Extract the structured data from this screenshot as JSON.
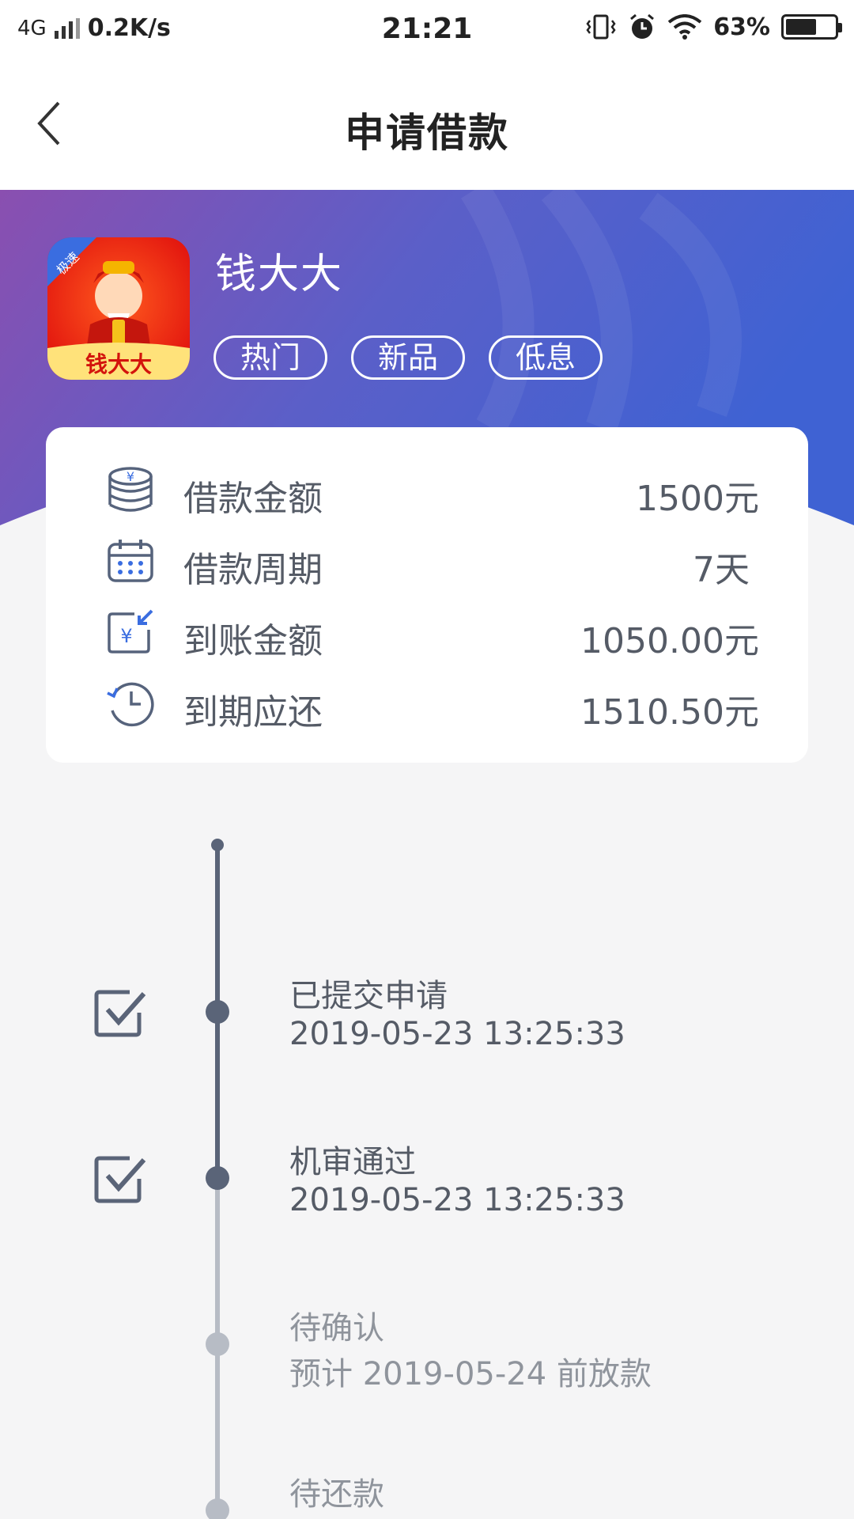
{
  "status_bar": {
    "network": "4G",
    "speed": "0.2K/s",
    "time": "21:21",
    "battery_percent_label": "63%",
    "battery_level": 0.63
  },
  "nav": {
    "title": "申请借款",
    "back_icon": "chevron-left-icon"
  },
  "product": {
    "name": "钱大大",
    "logo_badge": "极速",
    "logo_text": "钱大大",
    "tags": [
      "热门",
      "新品",
      "低息"
    ]
  },
  "loan_info": [
    {
      "icon": "coins-yen-icon",
      "label": "借款金额",
      "value": "1500元"
    },
    {
      "icon": "calendar-icon",
      "label": "借款周期",
      "value": "7天"
    },
    {
      "icon": "yen-receive-icon",
      "label": "到账金额",
      "value": "1050.00元"
    },
    {
      "icon": "clock-history-icon",
      "label": "到期应还",
      "value": "1510.50元"
    }
  ],
  "timeline": [
    {
      "title": "已提交申请",
      "subtitle": "2019-05-23 13:25:33",
      "done": true
    },
    {
      "title": "机审通过",
      "subtitle": "2019-05-23 13:25:33",
      "done": true
    },
    {
      "title": "待确认",
      "subtitle": "预计 2019-05-24 前放款",
      "done": false
    },
    {
      "title": "待还款",
      "subtitle": "",
      "done": false
    }
  ],
  "colors": {
    "banner_left": "#8a4fb0",
    "banner_right": "#4060d2",
    "text_primary": "#555b66",
    "done": "#5a6478",
    "pending": "#b7bcc5",
    "pending_text": "#8f949c"
  }
}
